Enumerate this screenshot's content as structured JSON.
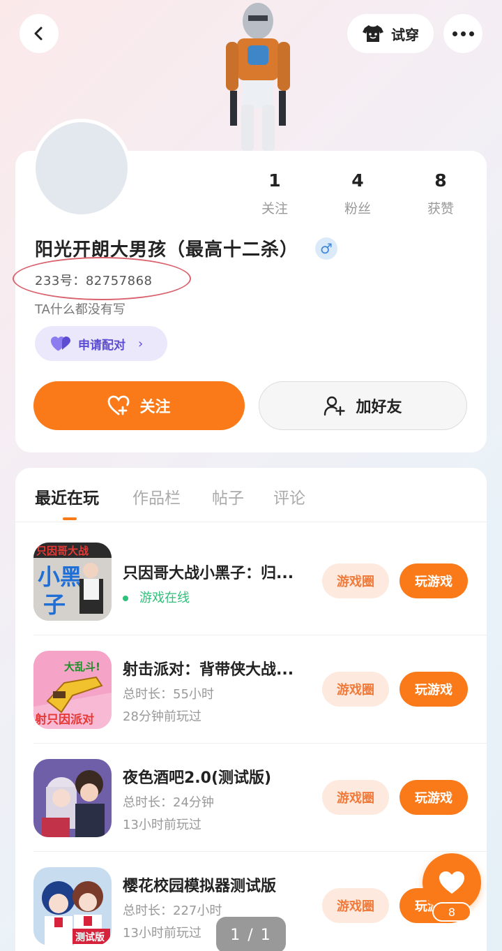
{
  "header": {
    "try_on_label": "试穿"
  },
  "profile": {
    "stats": [
      {
        "value": "1",
        "label": "关注"
      },
      {
        "value": "4",
        "label": "粉丝"
      },
      {
        "value": "8",
        "label": "获赞"
      }
    ],
    "username": "阳光开朗大男孩（最高十二杀）",
    "gender_symbol": "♂",
    "uid_text": "233号：82757868",
    "bio": "TA什么都没有写",
    "pair_label": "申请配对",
    "follow_label": "关注",
    "add_friend_label": "加好友"
  },
  "tabs": [
    {
      "label": "最近在玩"
    },
    {
      "label": "作品栏"
    },
    {
      "label": "帖子"
    },
    {
      "label": "评论"
    }
  ],
  "games": [
    {
      "title": "只因哥大战小黑子：归...",
      "line1": "游戏在线",
      "line2": "",
      "circle_label": "游戏圈",
      "play_label": "玩游戏"
    },
    {
      "title": "射击派对：背带侠大战...",
      "line1": "总时长：55小时",
      "line2": "28分钟前玩过",
      "circle_label": "游戏圈",
      "play_label": "玩游戏"
    },
    {
      "title": "夜色酒吧2.0(测试版)",
      "line1": "总时长：24分钟",
      "line2": "13小时前玩过",
      "circle_label": "游戏圈",
      "play_label": "玩游戏"
    },
    {
      "title": "樱花校园模拟器测试版",
      "line1": "总时长：227小时",
      "line2": "13小时前玩过",
      "circle_label": "游戏圈",
      "play_label": "玩游戏"
    }
  ],
  "icon_text": {
    "game1": [
      "只因哥大战",
      "小黑",
      "子"
    ],
    "game2": [
      "大乱斗!",
      "射只因派对"
    ],
    "game4": [
      "测试版"
    ]
  },
  "float_like_count": "8",
  "page_indicator": "1 / 1",
  "colors": {
    "accent": "#fa7a1a",
    "online": "#2fc07a",
    "pair": "#5b4cd1"
  }
}
